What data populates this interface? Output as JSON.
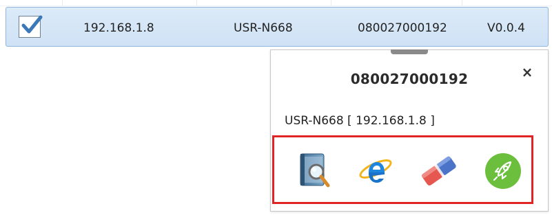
{
  "row": {
    "checked": true,
    "ip": "192.168.1.8",
    "model": "USR-N668",
    "mac": "080027000192",
    "version": "V0.0.4"
  },
  "popup": {
    "title": "080027000192",
    "close_glyph": "×",
    "info": "USR-N668  [ 192.168.1.8 ]",
    "tools": [
      {
        "icon": "search-config-icon"
      },
      {
        "icon": "internet-explorer-icon"
      },
      {
        "icon": "eraser-icon"
      },
      {
        "icon": "rocket-icon"
      }
    ],
    "highlight_color": "#e02424",
    "rocket_color": "#6cbf3d"
  }
}
